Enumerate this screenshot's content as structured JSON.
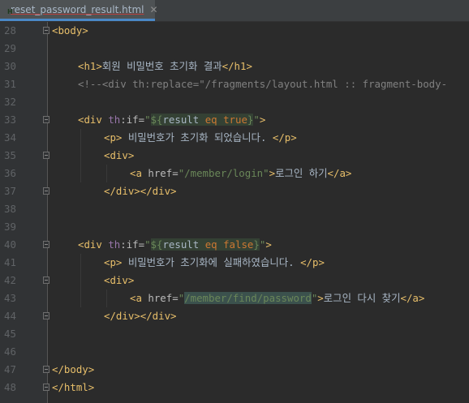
{
  "tab": {
    "filename": "reset_password_result.html",
    "close": "✕"
  },
  "lines": [
    {
      "n": "28",
      "segments": [
        {
          "t": "<body>",
          "c": "tag"
        }
      ],
      "indent": 0,
      "fold": true
    },
    {
      "n": "29",
      "segments": [],
      "indent": 0
    },
    {
      "n": "30",
      "segments": [
        {
          "t": "<h1>",
          "c": "tag"
        },
        {
          "t": "회원 비밀번호 초기화 결과",
          "c": ""
        },
        {
          "t": "</h1>",
          "c": "tag"
        }
      ],
      "indent": 1
    },
    {
      "n": "31",
      "segments": [
        {
          "t": "<!--<div th:replace=\"/fragments/layout.html :: fragment-body-",
          "c": "comment"
        }
      ],
      "indent": 1
    },
    {
      "n": "32",
      "segments": [],
      "indent": 0
    },
    {
      "n": "33",
      "segments": [
        {
          "t": "<div ",
          "c": "tag"
        },
        {
          "t": "th",
          "c": "attr-th"
        },
        {
          "t": ":if=",
          "c": "attr"
        },
        {
          "t": "\"",
          "c": "str"
        },
        {
          "t": "${",
          "c": "str expr"
        },
        {
          "t": "result ",
          "c": "expr"
        },
        {
          "t": "eq ",
          "c": "kw expr"
        },
        {
          "t": "true",
          "c": "lit expr"
        },
        {
          "t": "}",
          "c": "str expr"
        },
        {
          "t": "\"",
          "c": "str"
        },
        {
          "t": ">",
          "c": "tag"
        }
      ],
      "indent": 1,
      "fold": true
    },
    {
      "n": "34",
      "segments": [
        {
          "t": "<p>",
          "c": "tag"
        },
        {
          "t": " 비밀번호가 초기화 되었습니다. ",
          "c": ""
        },
        {
          "t": "</p>",
          "c": "tag"
        }
      ],
      "indent": 2
    },
    {
      "n": "35",
      "segments": [
        {
          "t": "<div>",
          "c": "tag"
        }
      ],
      "indent": 2,
      "fold": true
    },
    {
      "n": "36",
      "segments": [
        {
          "t": "<a ",
          "c": "tag"
        },
        {
          "t": "href=",
          "c": "attr"
        },
        {
          "t": "\"/member/login\"",
          "c": "str"
        },
        {
          "t": ">",
          "c": "tag"
        },
        {
          "t": "로그인 하기",
          "c": ""
        },
        {
          "t": "</a>",
          "c": "tag"
        }
      ],
      "indent": 3
    },
    {
      "n": "37",
      "segments": [
        {
          "t": "</div></div>",
          "c": "tag"
        }
      ],
      "indent": 2,
      "fold": true
    },
    {
      "n": "38",
      "segments": [],
      "indent": 0
    },
    {
      "n": "39",
      "segments": [],
      "indent": 0
    },
    {
      "n": "40",
      "segments": [
        {
          "t": "<div ",
          "c": "tag"
        },
        {
          "t": "th",
          "c": "attr-th"
        },
        {
          "t": ":if=",
          "c": "attr"
        },
        {
          "t": "\"",
          "c": "str"
        },
        {
          "t": "${",
          "c": "str expr"
        },
        {
          "t": "result ",
          "c": "expr"
        },
        {
          "t": "eq ",
          "c": "kw expr"
        },
        {
          "t": "false",
          "c": "lit expr"
        },
        {
          "t": "}",
          "c": "str expr"
        },
        {
          "t": "\"",
          "c": "str"
        },
        {
          "t": ">",
          "c": "tag"
        }
      ],
      "indent": 1,
      "fold": true
    },
    {
      "n": "41",
      "segments": [
        {
          "t": "<p>",
          "c": "tag"
        },
        {
          "t": " 비밀번호가 초기화에 실패하였습니다. ",
          "c": ""
        },
        {
          "t": "</p>",
          "c": "tag"
        }
      ],
      "indent": 2
    },
    {
      "n": "42",
      "segments": [
        {
          "t": "<div>",
          "c": "tag"
        }
      ],
      "indent": 2,
      "fold": true
    },
    {
      "n": "43",
      "segments": [
        {
          "t": "<a ",
          "c": "tag"
        },
        {
          "t": "href=",
          "c": "attr"
        },
        {
          "t": "\"",
          "c": "str"
        },
        {
          "t": "/member/find/password",
          "c": "str path-hl"
        },
        {
          "t": "\"",
          "c": "str"
        },
        {
          "t": ">",
          "c": "tag"
        },
        {
          "t": "로그인 다시 찾기",
          "c": ""
        },
        {
          "t": "</a>",
          "c": "tag"
        }
      ],
      "indent": 3
    },
    {
      "n": "44",
      "segments": [
        {
          "t": "</div></div>",
          "c": "tag"
        }
      ],
      "indent": 2,
      "fold": true
    },
    {
      "n": "45",
      "segments": [],
      "indent": 0
    },
    {
      "n": "46",
      "segments": [],
      "indent": 0
    },
    {
      "n": "47",
      "segments": [
        {
          "t": "</body>",
          "c": "tag"
        }
      ],
      "indent": 0,
      "fold": true
    },
    {
      "n": "48",
      "segments": [
        {
          "t": "</html>",
          "c": "tag"
        }
      ],
      "indent": 0,
      "fold": true
    }
  ]
}
